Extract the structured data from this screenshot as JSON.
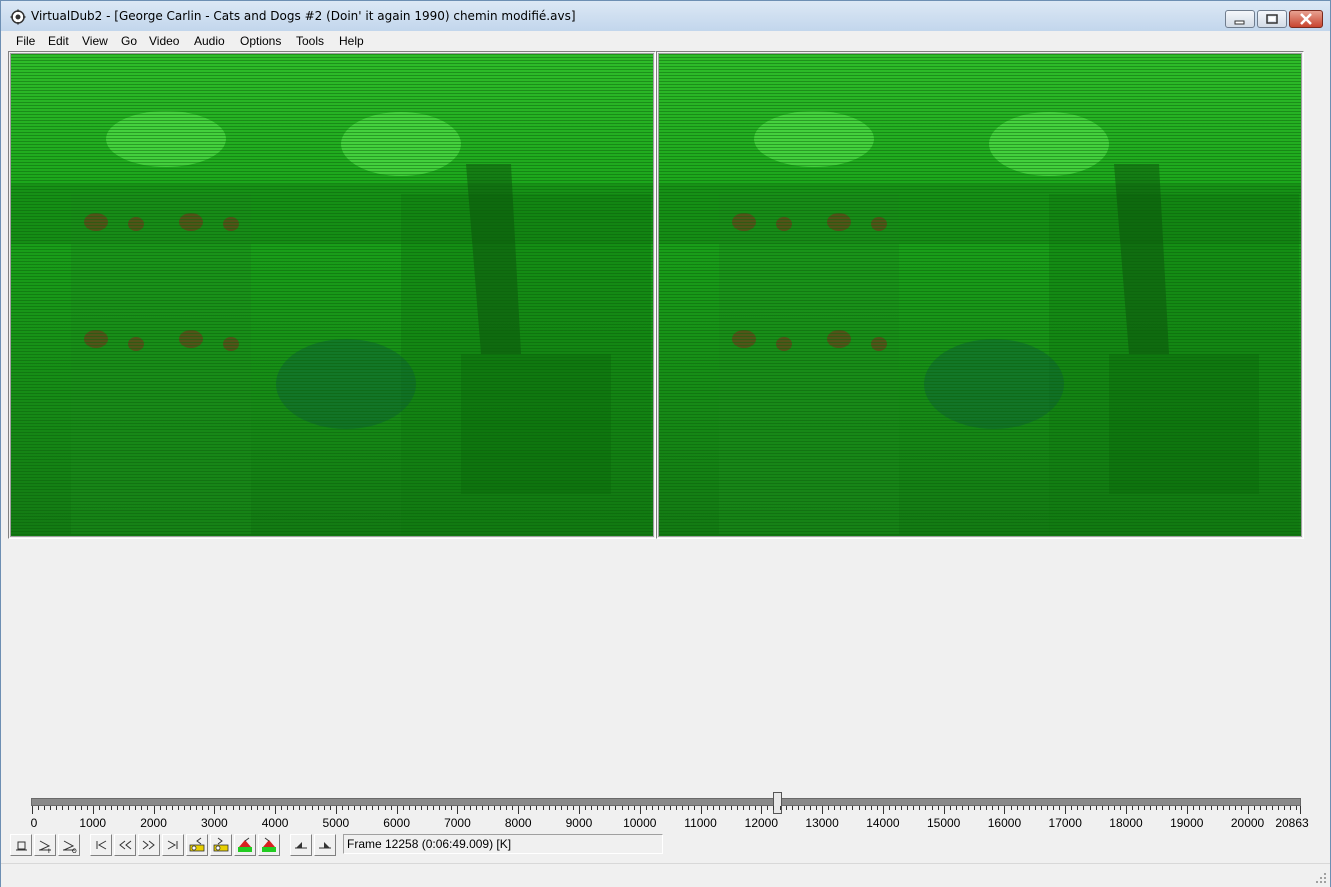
{
  "window": {
    "title": "VirtualDub2  - [George Carlin - Cats and Dogs #2 (Doin' it again 1990) chemin modifié.avs]",
    "controls": [
      "minimize",
      "maximize",
      "close"
    ]
  },
  "menu": {
    "items": [
      "File",
      "Edit",
      "View",
      "Go",
      "Video",
      "Audio",
      "Options",
      "Tools",
      "Help"
    ]
  },
  "panes": {
    "input_label": "input-video-pane",
    "output_label": "output-video-pane",
    "tint": "#1a8c1a"
  },
  "timeline": {
    "min": 0,
    "max": 20863,
    "current": 12258,
    "tick_labels": [
      "0",
      "1000",
      "2000",
      "3000",
      "4000",
      "5000",
      "6000",
      "7000",
      "8000",
      "9000",
      "10000",
      "11000",
      "12000",
      "13000",
      "14000",
      "15000",
      "16000",
      "17000",
      "18000",
      "19000",
      "20000",
      "20863"
    ]
  },
  "toolbar": {
    "buttons": [
      "stop-icon",
      "play-input-icon",
      "play-output-icon",
      "go-start-icon",
      "prev-frame-icon",
      "next-frame-icon",
      "go-end-icon",
      "prev-keyframe-icon",
      "next-keyframe-icon",
      "prev-scene-icon",
      "next-scene-icon",
      "mark-in-icon",
      "mark-out-icon"
    ]
  },
  "status": {
    "frame_text": "Frame 12258 (0:06:49.009) [K]"
  },
  "colors": {
    "accent": "#1a8c1a",
    "title_gradient_top": "#dce8f5",
    "title_gradient_bottom": "#c2d6ec"
  }
}
